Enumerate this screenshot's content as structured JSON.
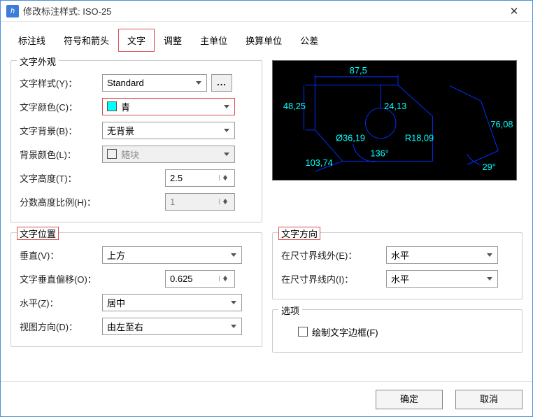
{
  "window": {
    "title": "修改标注样式: ISO-25"
  },
  "tabs": {
    "items": [
      "标注线",
      "符号和箭头",
      "文字",
      "调整",
      "主单位",
      "换算单位",
      "公差"
    ],
    "active": 2
  },
  "appearance": {
    "title": "文字外观",
    "style_label": "文字样式(Y)：",
    "style_value": "Standard",
    "color_label": "文字颜色(C)：",
    "color_value": "青",
    "color_hex": "#00ffff",
    "bg_label": "文字背景(B)：",
    "bg_value": "无背景",
    "bgcolor_label": "背景颜色(L)：",
    "bgcolor_value": "随块",
    "height_label": "文字高度(T)：",
    "height_value": "2.5",
    "frac_label": "分数高度比例(H)：",
    "frac_value": "1"
  },
  "position": {
    "title": "文字位置",
    "vert_label": "垂直(V)：",
    "vert_value": "上方",
    "voff_label": "文字垂直偏移(O)：",
    "voff_value": "0.625",
    "horiz_label": "水平(Z)：",
    "horiz_value": "居中",
    "view_label": "视图方向(D)：",
    "view_value": "由左至右"
  },
  "direction": {
    "title": "文字方向",
    "out_label": "在尺寸界线外(E)：",
    "out_value": "水平",
    "in_label": "在尺寸界线内(I)：",
    "in_value": "水平"
  },
  "options": {
    "title": "选项",
    "drawframe_label": "绘制文字边框(F)"
  },
  "preview": {
    "dims": {
      "top": "87,5",
      "left": "48,25",
      "inner": "24,13",
      "right": "76,08",
      "diam": "Ø36,19",
      "rad": "R18,09",
      "bottom": "103,74",
      "ang1": "136°",
      "ang2": "29°"
    }
  },
  "footer": {
    "ok": "确定",
    "cancel": "取消"
  }
}
